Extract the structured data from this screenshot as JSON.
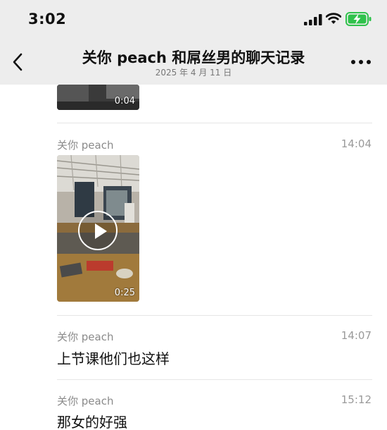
{
  "status_bar": {
    "time": "3:02"
  },
  "nav": {
    "title": "关你 peach 和屌丝男的聊天记录",
    "date": "2025 年 4 月 11 日"
  },
  "messages": [
    {
      "type": "video",
      "duration": "0:04"
    },
    {
      "sender": "关你 peach",
      "time": "14:04",
      "type": "video",
      "duration": "0:25"
    },
    {
      "sender": "关你 peach",
      "time": "14:07",
      "type": "text",
      "text": "上节课他们也这样"
    },
    {
      "sender": "关你 peach",
      "time": "15:12",
      "type": "text",
      "text": "那女的好强"
    }
  ],
  "colors": {
    "header_bg": "#ededed",
    "battery_green": "#30c24c",
    "sender_gray": "#8a8a8a"
  },
  "icons": [
    "signal-icon",
    "wifi-icon",
    "battery-charging-icon",
    "back-chevron-icon",
    "more-dots-icon",
    "play-icon"
  ]
}
